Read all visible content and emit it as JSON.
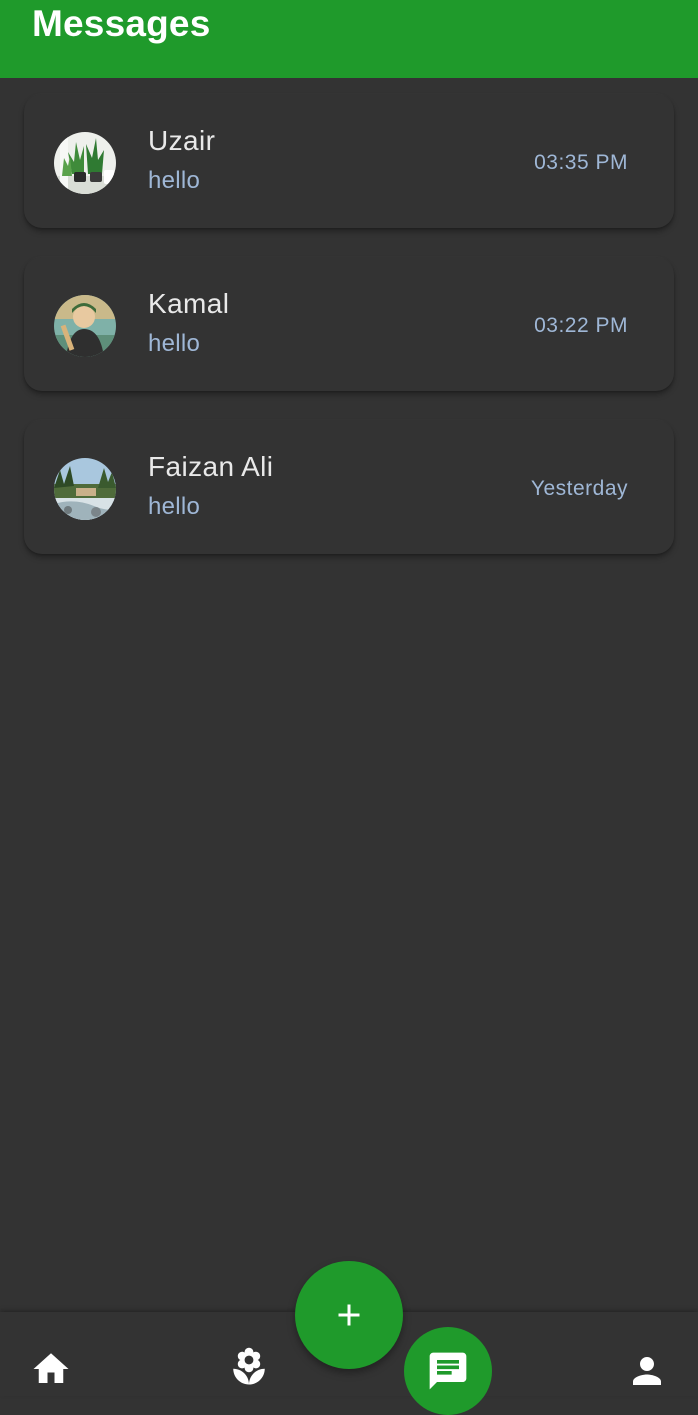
{
  "header": {
    "title": "Messages",
    "color": "#1f9a2b"
  },
  "conversations": [
    {
      "name": "Uzair",
      "last_message": "hello",
      "time": "03:35 PM",
      "avatar": "avatar-plants"
    },
    {
      "name": "Kamal",
      "last_message": "hello",
      "time": "03:22 PM",
      "avatar": "avatar-cartoon-boy"
    },
    {
      "name": "Faizan Ali",
      "last_message": "hello",
      "time": "Yesterday",
      "avatar": "avatar-river-landscape"
    }
  ],
  "bottom_nav": {
    "items": [
      "home-icon",
      "flower-icon",
      "chat-icon",
      "person-icon"
    ],
    "active": "chat-icon"
  },
  "fab": {
    "icon": "plus-icon"
  }
}
